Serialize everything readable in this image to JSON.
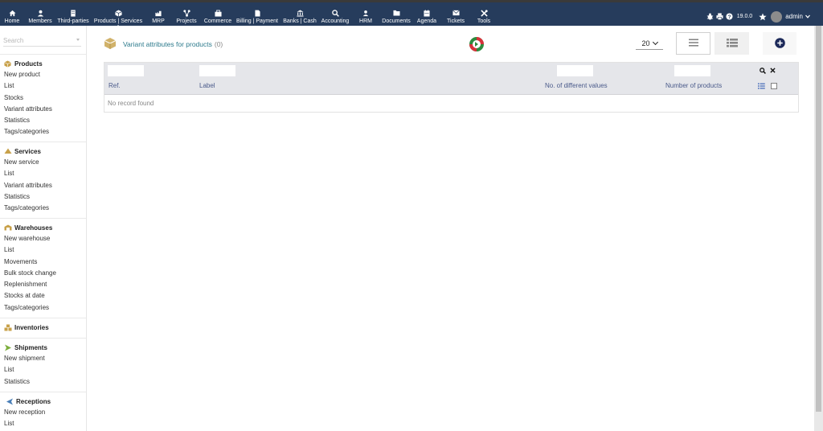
{
  "topnav": {
    "items": [
      {
        "label": "Home",
        "icon": "home-icon"
      },
      {
        "label": "Members",
        "icon": "members-icon"
      },
      {
        "label": "Third-parties",
        "icon": "building-icon"
      },
      {
        "label": "Products | Services",
        "icon": "cube-icon",
        "active": true
      },
      {
        "label": "MRP",
        "icon": "mrp-icon"
      },
      {
        "label": "Projects",
        "icon": "projects-icon"
      },
      {
        "label": "Commerce",
        "icon": "commerce-icon"
      },
      {
        "label": "Billing | Payment",
        "icon": "invoice-icon"
      },
      {
        "label": "Banks | Cash",
        "icon": "bank-icon"
      },
      {
        "label": "Accounting",
        "icon": "accounting-icon"
      },
      {
        "label": "HRM",
        "icon": "user-icon"
      },
      {
        "label": "Documents",
        "icon": "folder-icon"
      },
      {
        "label": "Agenda",
        "icon": "calendar-icon"
      },
      {
        "label": "Tickets",
        "icon": "ticket-icon"
      },
      {
        "label": "Tools",
        "icon": "tools-icon"
      }
    ],
    "version": "19.0.0",
    "user": "admin"
  },
  "sidebar": {
    "search_placeholder": "Search",
    "sections": [
      {
        "title": "Products",
        "icon": "cube-icon",
        "items": [
          "New product",
          "List",
          "Stocks",
          "Variant attributes",
          "Statistics",
          "Tags/categories"
        ]
      },
      {
        "title": "Services",
        "icon": "services-icon",
        "items": [
          "New service",
          "List",
          "Variant attributes",
          "Statistics",
          "Tags/categories"
        ]
      },
      {
        "title": "Warehouses",
        "icon": "warehouse-icon",
        "items": [
          "New warehouse",
          "List",
          "Movements",
          "Bulk stock change",
          "Replenishment",
          "Stocks at date",
          "Tags/categories"
        ]
      },
      {
        "title": "Inventories",
        "icon": "inventory-icon",
        "items": []
      },
      {
        "title": "Shipments",
        "icon": "shipment-icon",
        "items": [
          "New shipment",
          "List",
          "Statistics"
        ]
      },
      {
        "title": "Receptions",
        "icon": "reception-icon",
        "items": [
          "New reception",
          "List"
        ]
      }
    ]
  },
  "main": {
    "title": "Variant attributes for products",
    "count": "(0)",
    "page_size": "20",
    "columns": [
      "Ref.",
      "Label",
      "No. of different values",
      "Number of products"
    ],
    "empty_message": "No record found"
  },
  "colors": {
    "topbar": "#263c5c",
    "title": "#2c7a8c",
    "column_header": "#4a5a8a",
    "table_head_bg": "#e5e6ea"
  }
}
